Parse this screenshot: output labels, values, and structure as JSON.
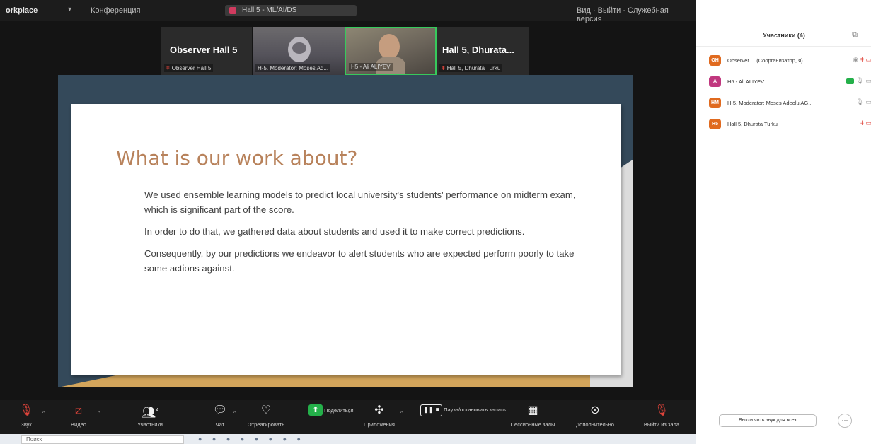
{
  "titlebar": {
    "app_name": "orkplace",
    "conference_label": "Конференция",
    "meeting_title": "Hall 5 - ML/AI/DS",
    "right_info": "Вид  ·  Выйти  ·  Служебная версия"
  },
  "tiles": [
    {
      "name": "Observer Hall 5",
      "caption": "Observer Hall 5"
    },
    {
      "caption": "H-5. Moderator: Moses Ad..."
    },
    {
      "caption": "H5 - Ali ALIYEV"
    },
    {
      "name": "Hall 5, Dhurata...",
      "caption": "Hall 5, Dhurata Turku"
    }
  ],
  "slide": {
    "title": "What is our work about?",
    "paragraphs": [
      "We used ensemble learning models to predict local university's students' performance on midterm exam, which is significant part of the score.",
      "In order to do that, we gathered data about students and used it to make correct predictions.",
      "Consequently, by our predictions we endeavor to alert students who are expected perform poorly to take some actions against."
    ]
  },
  "toolbar": {
    "audio": "Звук",
    "video": "Видео",
    "participants": "Участники",
    "participants_count": "4",
    "chat": "Чат",
    "react": "Отреагировать",
    "share": "Поделиться",
    "apps": "Приложения",
    "record": "Пауза/остановить запись",
    "rooms": "Сессионные залы",
    "more": "Дополнительно",
    "leave": "Выйти из зала"
  },
  "panel": {
    "title": "Участники (4)",
    "participants": [
      {
        "initials": "OH",
        "name": "Observer ... (Соорганизатор, я)",
        "color": "#e06a1f"
      },
      {
        "initials": "A",
        "name": "H5 - Ali ALIYEV",
        "color": "#c0377e"
      },
      {
        "initials": "HM",
        "name": "H-5. Moderator: Moses Adeolu AG...",
        "color": "#e06a1f"
      },
      {
        "initials": "H5",
        "name": "Hall 5, Dhurata Turku",
        "color": "#e06a1f"
      }
    ],
    "mute_all": "Выключить звук для всех",
    "more": "···"
  },
  "taskbar": {
    "search_placeholder": "Поиск"
  }
}
